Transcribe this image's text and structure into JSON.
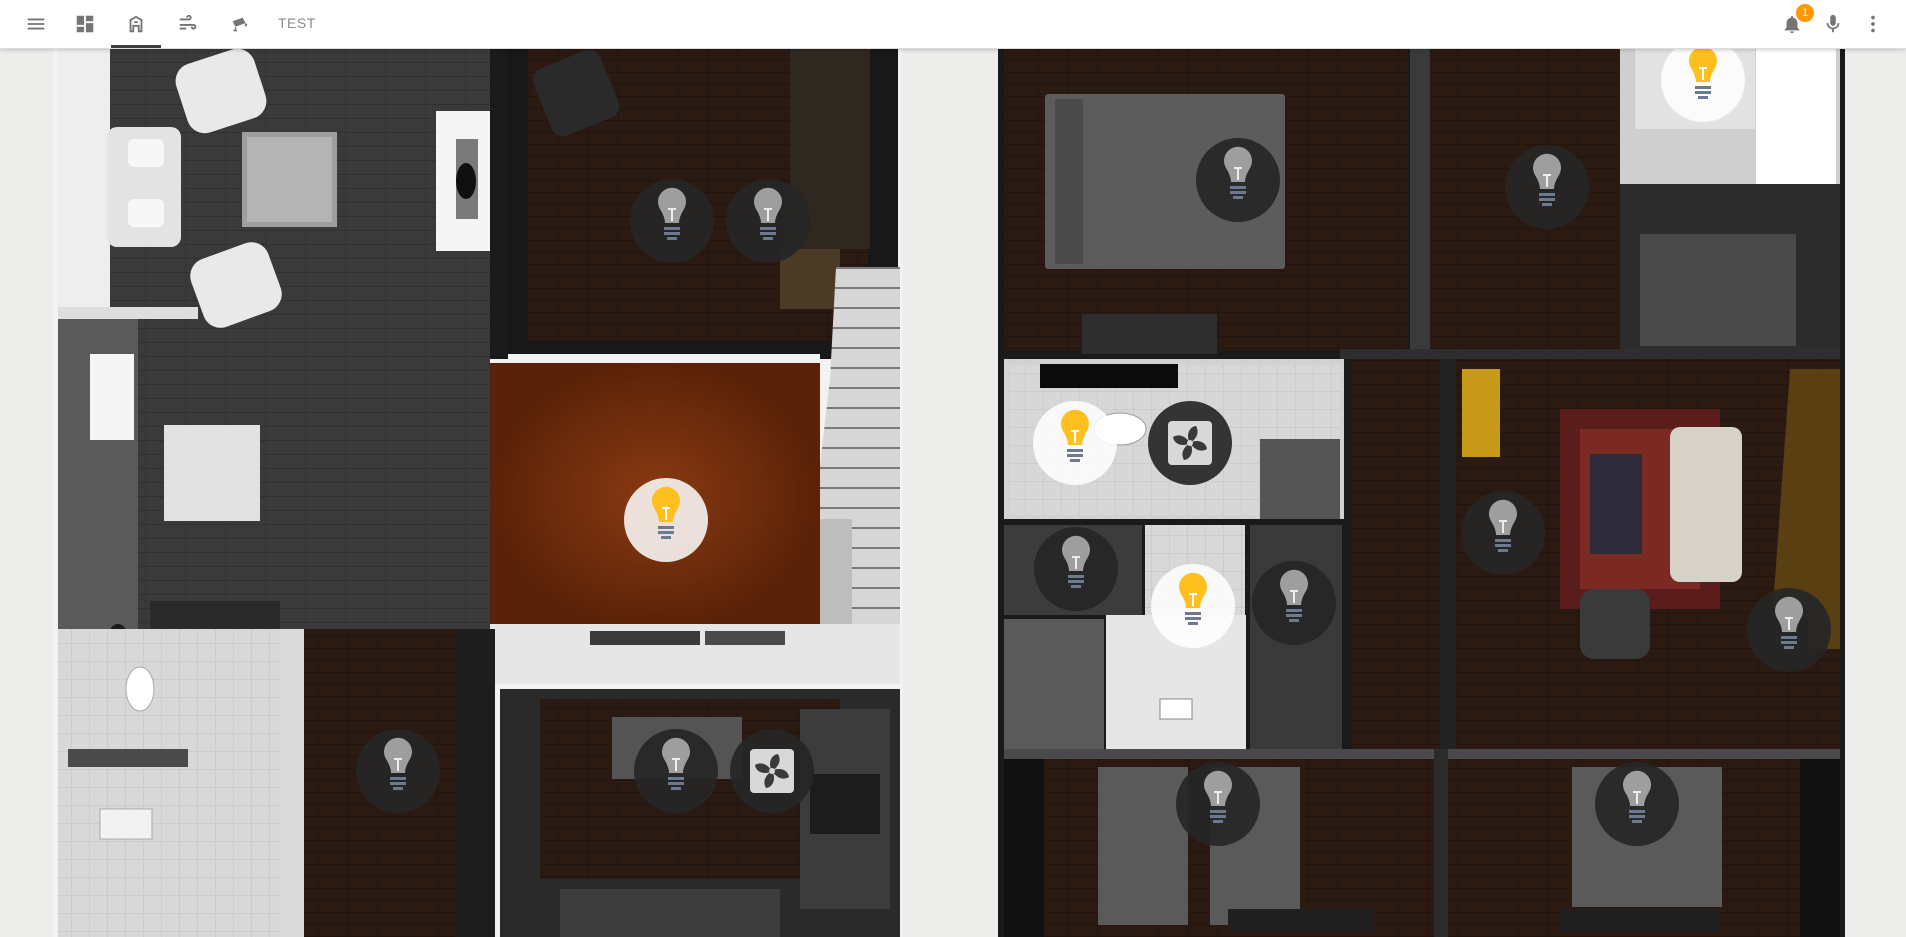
{
  "toolbar": {
    "icons": [
      "menu-icon",
      "dashboard-icon",
      "floorplan-icon",
      "weather-icon",
      "camera-icon",
      "bell-icon",
      "microphone-icon",
      "more-vert-icon"
    ],
    "active_view": "floorplan-view",
    "test_tab_label": "TEST",
    "notification_count": "1"
  },
  "floorplan": {
    "colors": {
      "light_on": "#ffbf1f",
      "light_off": "#262626",
      "bulb_off": "#9e9e9e",
      "dark_floor": "#2a1a12",
      "dining_floor": "#6a2a0c"
    },
    "rooms_left": [
      "living-room",
      "study",
      "dining-room",
      "toilet",
      "hallway",
      "kitchen"
    ],
    "rooms_right": [
      "bedroom-master",
      "bedroom-2",
      "bedroom-3",
      "bathroom",
      "laundry",
      "shower-room",
      "lounge",
      "bedroom-4",
      "bedroom-5"
    ],
    "lights": [
      {
        "name": "study-light-1",
        "state": "off"
      },
      {
        "name": "study-light-2",
        "state": "off"
      },
      {
        "name": "dining-light",
        "state": "on"
      },
      {
        "name": "hallway-light",
        "state": "off"
      },
      {
        "name": "kitchen-light",
        "state": "off"
      },
      {
        "name": "master-bedroom-light",
        "state": "off"
      },
      {
        "name": "bedroom-2-light",
        "state": "off"
      },
      {
        "name": "bedroom-3-light",
        "state": "on"
      },
      {
        "name": "bathroom-light",
        "state": "on"
      },
      {
        "name": "laundry-light",
        "state": "off"
      },
      {
        "name": "shower-light",
        "state": "on"
      },
      {
        "name": "ensuite-light",
        "state": "off"
      },
      {
        "name": "lounge-light",
        "state": "off"
      },
      {
        "name": "stair-light",
        "state": "off"
      },
      {
        "name": "bedroom-4-light",
        "state": "off"
      },
      {
        "name": "bedroom-5-light",
        "state": "off"
      }
    ],
    "fans": [
      {
        "name": "kitchen-fan",
        "state": "off"
      },
      {
        "name": "bathroom-fan",
        "state": "off"
      }
    ]
  }
}
